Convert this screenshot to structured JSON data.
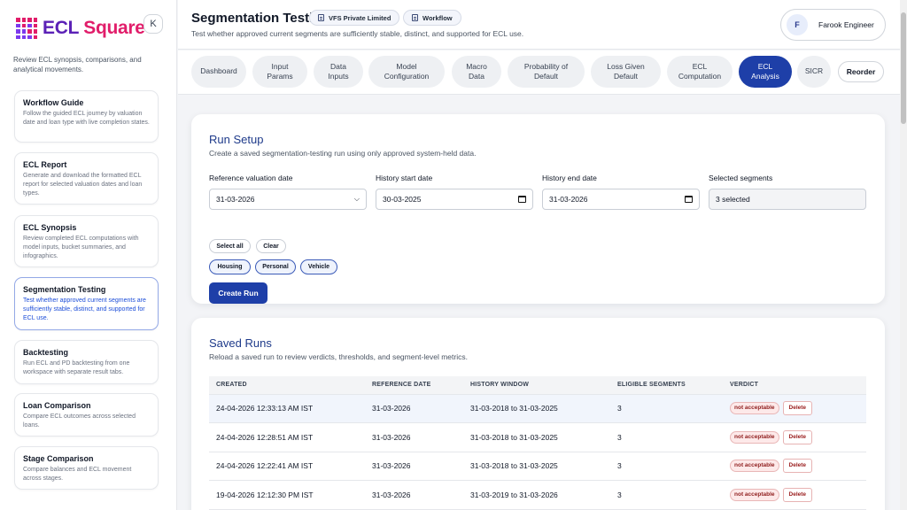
{
  "sidebar": {
    "logo_text_1": "ECL",
    "logo_text_2": "Square",
    "collapse_label": "K",
    "description": "Review ECL synopsis, comparisons, and analytical movements.",
    "items": [
      {
        "title": "Workflow Guide",
        "desc": "Follow the guided ECL journey by valuation date and loan type with live completion states."
      },
      {
        "title": "ECL Report",
        "desc": "Generate and download the formatted ECL report for selected valuation dates and loan types."
      },
      {
        "title": "ECL Synopsis",
        "desc": "Review completed ECL computations with model inputs, bucket summaries, and infographics."
      },
      {
        "title": "Segmentation Testing",
        "desc": "Test whether approved current segments are sufficiently stable, distinct, and supported for ECL use."
      },
      {
        "title": "Backtesting",
        "desc": "Run ECL and PD backtesting from one workspace with separate result tabs."
      },
      {
        "title": "Loan Comparison",
        "desc": "Compare ECL outcomes across selected loans."
      },
      {
        "title": "Stage Comparison",
        "desc": "Compare balances and ECL movement across stages."
      }
    ]
  },
  "header": {
    "title": "Segmentation Testing",
    "chip_company": "VFS Private Limited",
    "chip_workflow": "Workflow",
    "subtitle": "Test whether approved current segments are sufficiently stable, distinct, and supported for ECL use.",
    "user_initial": "F",
    "user_name": "Farook Engineer"
  },
  "tabs": [
    "Dashboard",
    "Input Params",
    "Data Inputs",
    "Model Configuration",
    "Macro Data",
    "Probability of Default",
    "Loss Given Default",
    "ECL Computation",
    "ECL Analysis",
    "SICR"
  ],
  "reorder_label": "Reorder",
  "run_setup": {
    "title": "Run Setup",
    "subtitle": "Create a saved segmentation-testing run using only approved system-held data.",
    "ref_label": "Reference valuation date",
    "ref_value": "31-03-2026",
    "hist_start_label": "History start date",
    "hist_start_value": "30-03-2025",
    "hist_end_label": "History end date",
    "hist_end_value": "31-03-2026",
    "segments_label": "Selected segments",
    "segments_value": "3 selected",
    "select_all": "Select all",
    "clear": "Clear",
    "segments": [
      "Housing",
      "Personal",
      "Vehicle"
    ],
    "create_button": "Create Run"
  },
  "saved_runs": {
    "title": "Saved Runs",
    "subtitle": "Reload a saved run to review verdicts, thresholds, and segment-level metrics.",
    "columns": [
      "CREATED",
      "REFERENCE DATE",
      "HISTORY WINDOW",
      "ELIGIBLE SEGMENTS",
      "VERDICT"
    ],
    "rows": [
      {
        "created": "24-04-2026 12:33:13 AM IST",
        "reference": "31-03-2026",
        "window": "31-03-2018 to 31-03-2025",
        "eligible": "3",
        "verdict": "not acceptable",
        "delete": "Delete"
      },
      {
        "created": "24-04-2026 12:28:51 AM IST",
        "reference": "31-03-2026",
        "window": "31-03-2018 to 31-03-2025",
        "eligible": "3",
        "verdict": "not acceptable",
        "delete": "Delete"
      },
      {
        "created": "24-04-2026 12:22:41 AM IST",
        "reference": "31-03-2026",
        "window": "31-03-2018 to 31-03-2025",
        "eligible": "3",
        "verdict": "not acceptable",
        "delete": "Delete"
      },
      {
        "created": "19-04-2026 12:12:30 PM IST",
        "reference": "31-03-2026",
        "window": "31-03-2019 to 31-03-2026",
        "eligible": "3",
        "verdict": "not acceptable",
        "delete": "Delete"
      }
    ]
  },
  "colors": {
    "accent": "#1e3fa8",
    "title_blue": "#1e3a8a",
    "verdict_red": "#8f1d1d"
  }
}
